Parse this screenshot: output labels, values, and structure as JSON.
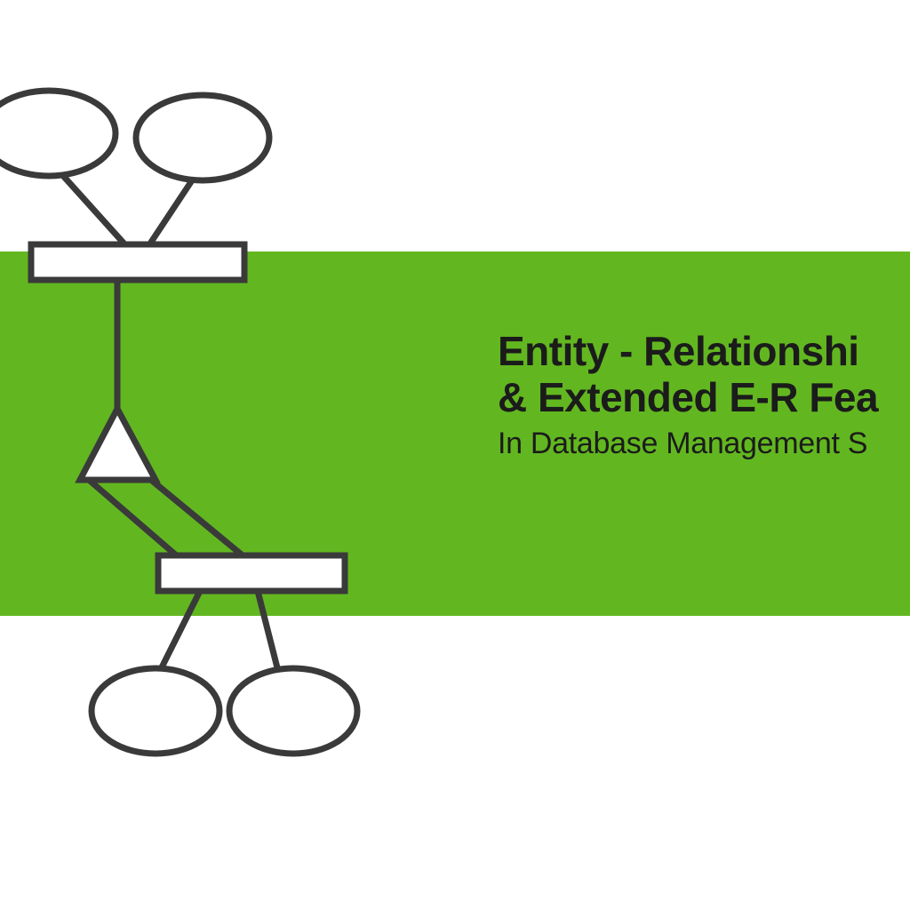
{
  "colors": {
    "band": "#62b720",
    "stroke": "#3a3a3a",
    "fill": "#ffffff",
    "text": "#1b1b1b"
  },
  "title": {
    "line1": "Entity - Relationshi",
    "line2": "& Extended E-R Fea",
    "subtitle": "In Database Management S"
  },
  "diagram": {
    "type": "er-hierarchy",
    "shapes": [
      {
        "kind": "ellipse",
        "role": "attribute-top-left"
      },
      {
        "kind": "ellipse",
        "role": "attribute-top-right"
      },
      {
        "kind": "rect",
        "role": "entity-top"
      },
      {
        "kind": "triangle",
        "role": "isa"
      },
      {
        "kind": "rect",
        "role": "entity-bottom"
      },
      {
        "kind": "ellipse",
        "role": "attribute-bottom-left"
      },
      {
        "kind": "ellipse",
        "role": "attribute-bottom-right"
      }
    ]
  }
}
